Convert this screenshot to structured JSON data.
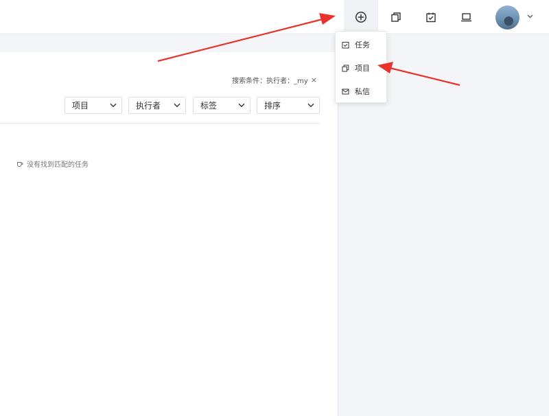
{
  "header": {
    "icons": [
      "plus-circle-icon",
      "copy-icon",
      "calendar-check-icon",
      "laptop-icon"
    ],
    "avatar": "user-avatar"
  },
  "search": {
    "label": "搜索条件：执行者：_my",
    "clear": "×"
  },
  "filters": [
    "项目",
    "执行者",
    "标签",
    "排序"
  ],
  "empty_message": "没有找到匹配的任务",
  "dropdown": {
    "items": [
      {
        "label": "任务",
        "icon": "task-check-icon"
      },
      {
        "label": "项目",
        "icon": "project-copy-icon"
      },
      {
        "label": "私信",
        "icon": "mail-icon"
      }
    ]
  },
  "colors": {
    "arrow": "#e8322b",
    "panel_bg": "#f3f5f8",
    "border": "#e6e8ec"
  }
}
